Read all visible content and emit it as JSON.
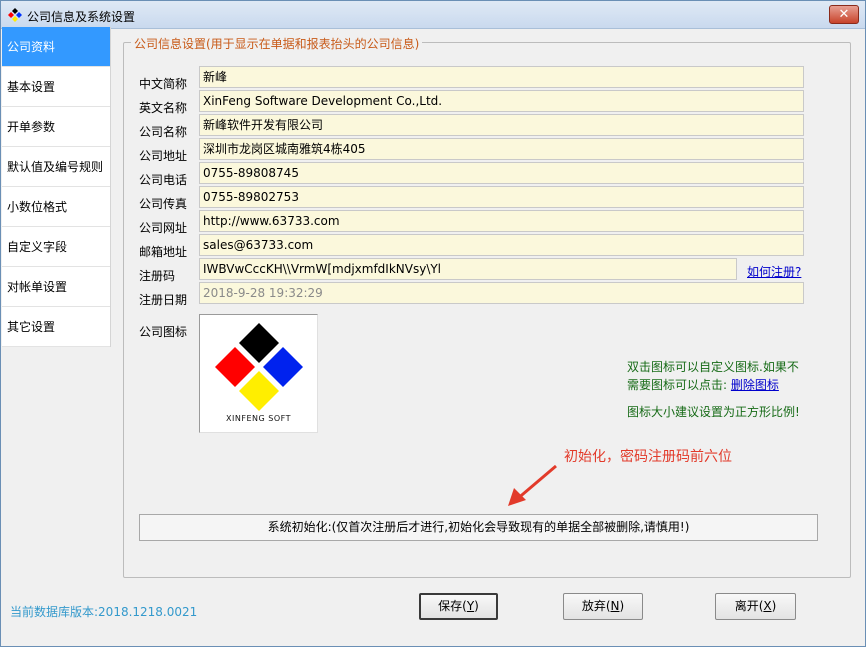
{
  "window": {
    "title": "公司信息及系统设置",
    "close_label": "✕"
  },
  "sidebar": {
    "items": [
      {
        "label": "公司资料",
        "active": true
      },
      {
        "label": "基本设置"
      },
      {
        "label": "开单参数"
      },
      {
        "label": "默认值及编号规则"
      },
      {
        "label": "小数位格式"
      },
      {
        "label": "自定义字段"
      },
      {
        "label": "对帐单设置"
      },
      {
        "label": "其它设置"
      }
    ]
  },
  "company": {
    "legend": "公司信息设置(用于显示在单据和报表抬头的公司信息)",
    "fields": [
      {
        "label": "中文简称",
        "value": "新峰"
      },
      {
        "label": "英文名称",
        "value": "XinFeng Software Development Co.,Ltd."
      },
      {
        "label": "公司名称",
        "value": "新峰软件开发有限公司"
      },
      {
        "label": "公司地址",
        "value": "深圳市龙岗区城南雅筑4栋405"
      },
      {
        "label": "公司电话",
        "value": "0755-89808745"
      },
      {
        "label": "公司传真",
        "value": "0755-89802753"
      },
      {
        "label": "公司网址",
        "value": "http://www.63733.com"
      },
      {
        "label": "邮箱地址",
        "value": "sales@63733.com"
      }
    ],
    "reg_code": {
      "label": "注册码",
      "value": "IWBVwCccKH\\\\VrmW[mdjxmfdIkNVsy\\Yl",
      "link": "如何注册?"
    },
    "reg_date": {
      "label": "注册日期",
      "value": "2018-9-28 19:32:29"
    },
    "logo": {
      "label": "公司图标",
      "caption": "XINFENG SOFT"
    },
    "hints": {
      "line1": "双击图标可以自定义图标.如果不",
      "line2": "需要图标可以点击:",
      "delete_link": "删除图标",
      "line3": "图标大小建议设置为正方形比例!"
    },
    "annotation": "初始化，密码注册码前六位",
    "init_button": "系统初始化:(仅首次注册后才进行,初始化会导致现有的单据全部被删除,请慎用!)"
  },
  "footer": {
    "db_version": "当前数据库版本:2018.1218.0021",
    "save": {
      "text": "保存(",
      "key": "Y",
      "end": ")"
    },
    "discard": {
      "text": "放弃(",
      "key": "N",
      "end": ")"
    },
    "leave": {
      "text": "离开(",
      "key": "X",
      "end": ")"
    }
  },
  "colors": {
    "accent": "#3399ff",
    "legend": "#c85a18",
    "input_bg": "#fbf8dc",
    "hint": "#176b17",
    "annotation": "#e23a2a"
  }
}
